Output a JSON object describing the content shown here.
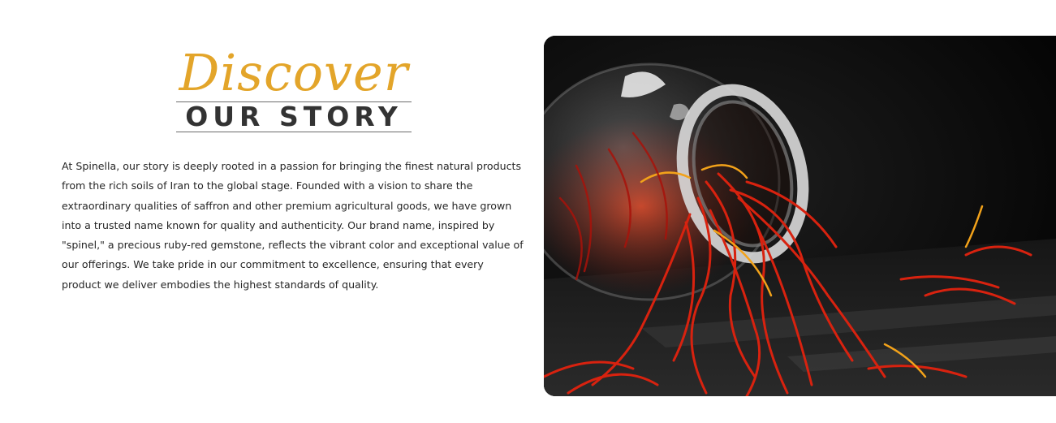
{
  "story": {
    "heading_script": "Discover",
    "heading_main": "OUR STORY",
    "paragraph": "At Spinella, our story is deeply rooted in a passion for bringing the finest natural products from the rich soils of Iran to the global stage. Founded with a vision to share the extraordinary qualities of saffron and other premium agricultural goods, we have grown into a trusted name known for quality and authenticity. Our brand name, inspired by \"spinel,\" a precious ruby-red gemstone, reflects the vibrant color and exceptional value of our offerings. We take pride in our commitment to excellence, ensuring that every product we deliver embodies the highest standards of quality."
  },
  "colors": {
    "accent_gold": "#e3a52a",
    "heading_dark": "#333333",
    "saffron_red": "#d8220f"
  },
  "image": {
    "subject": "saffron-jar-photo"
  }
}
